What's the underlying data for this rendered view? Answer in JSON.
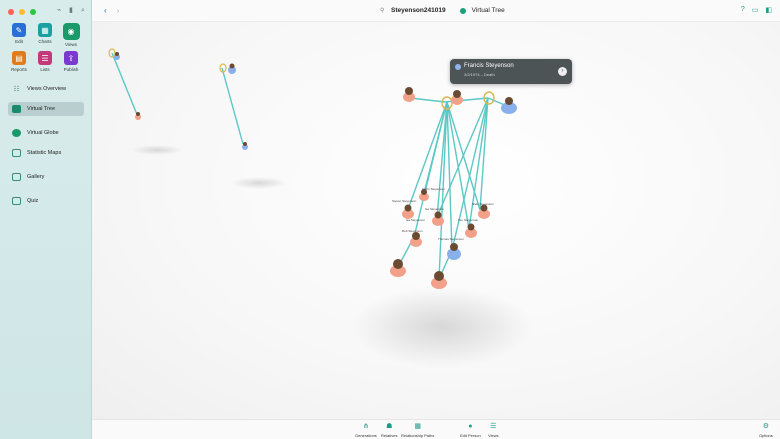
{
  "window": {
    "title": "Steyenson241019",
    "view_name": "Virtual Tree"
  },
  "sidebar": {
    "grid": [
      {
        "label": "Edit",
        "icon": "pencil-icon",
        "color": "#2a6fd6",
        "glyph": "✎"
      },
      {
        "label": "Charts",
        "icon": "charts-icon",
        "color": "#1aa0a0",
        "glyph": "▦"
      },
      {
        "label": "Views",
        "icon": "eye-icon",
        "color": "#1a9a6a",
        "glyph": "◉"
      },
      {
        "label": "Reports",
        "icon": "reports-icon",
        "color": "#e07a1a",
        "glyph": "▤"
      },
      {
        "label": "Lists",
        "icon": "lists-icon",
        "color": "#c23a7a",
        "glyph": "☰"
      },
      {
        "label": "Publish",
        "icon": "publish-icon",
        "color": "#7a3ad0",
        "glyph": "⇪"
      }
    ],
    "items": [
      {
        "label": "Views Overview",
        "icon": "views-overview-icon",
        "color": "#5b8a8a"
      },
      {
        "label": "Virtual Tree",
        "icon": "virtual-tree-icon",
        "color": "#1a8a6a"
      },
      {
        "label": "Virtual Globe",
        "icon": "virtual-globe-icon",
        "color": "#1a9a6a"
      },
      {
        "label": "Statistic Maps",
        "icon": "statistic-maps-icon",
        "color": "#3a8a7a"
      },
      {
        "label": "Gallery",
        "icon": "gallery-icon",
        "color": "#3a8a7a"
      },
      {
        "label": "Quiz",
        "icon": "quiz-icon",
        "color": "#3a8a7a"
      }
    ]
  },
  "tooltip": {
    "name": "Francis Steyenson",
    "meta": "3/2/1974 – Death"
  },
  "tree_labels": [
    "Steven Steyenson",
    "Isa Steyenson",
    "Niels Steyenson",
    "Kim Steyenson",
    "Rob Steyenson",
    "Thomas Steyenson",
    "Katrin Steyenson",
    "Isa Steyenson"
  ],
  "bottombar": [
    {
      "label": "Generations",
      "icon": "generations-icon"
    },
    {
      "label": "Relatives",
      "icon": "relatives-icon"
    },
    {
      "label": "Relationship Paths",
      "icon": "relationship-paths-icon"
    },
    {
      "label": "Edit Person",
      "icon": "edit-person-icon"
    },
    {
      "label": "Views",
      "icon": "views-icon"
    },
    {
      "label": "Options",
      "icon": "options-icon"
    }
  ],
  "colors": {
    "accent": "#1d9a8a",
    "link": "#5cc8c4",
    "female": "#f2a08a",
    "male": "#8ab0ec"
  }
}
